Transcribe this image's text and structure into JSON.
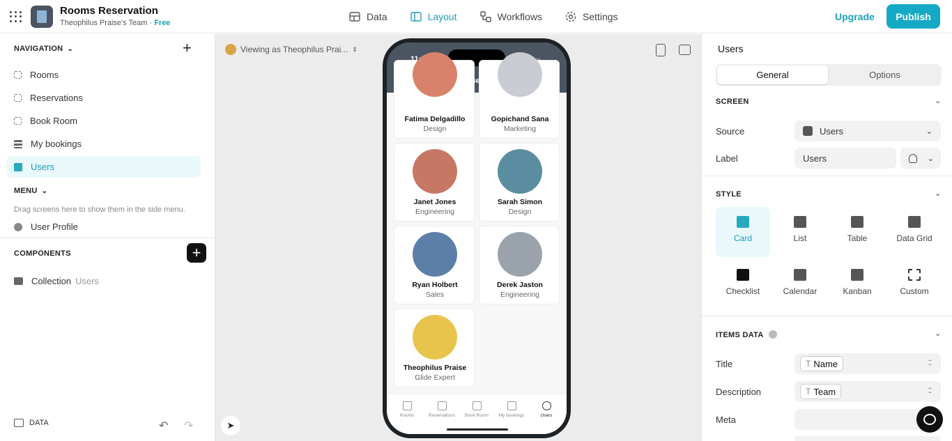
{
  "app": {
    "title": "Rooms Reservation",
    "team": "Theophilus Praise's Team",
    "plan": "Free",
    "separator": " · "
  },
  "tabs": [
    {
      "label": "Data"
    },
    {
      "label": "Layout"
    },
    {
      "label": "Workflows"
    },
    {
      "label": "Settings"
    }
  ],
  "header": {
    "upgrade": "Upgrade",
    "publish": "Publish"
  },
  "left": {
    "navigation_header": "NAVIGATION",
    "nav_items": [
      {
        "label": "Rooms"
      },
      {
        "label": "Reservations"
      },
      {
        "label": "Book Room"
      },
      {
        "label": "My bookings"
      },
      {
        "label": "Users"
      }
    ],
    "menu_header": "MENU",
    "menu_hint": "Drag screens here to show them in the side menu.",
    "menu_item": "User Profile",
    "components_header": "COMPONENTS",
    "component": {
      "label": "Collection",
      "source": "Users"
    },
    "data_label": "DATA"
  },
  "canvas": {
    "viewing_as": "Viewing as Theophilus Prai...",
    "phone": {
      "time": "11:57",
      "title": "Users",
      "users": [
        {
          "name": "Fatima Delgadillo",
          "team": "Design"
        },
        {
          "name": "Gopichand Sana",
          "team": "Marketing"
        },
        {
          "name": "Janet Jones",
          "team": "Engineering"
        },
        {
          "name": "Sarah Simon",
          "team": "Design"
        },
        {
          "name": "Ryan Holbert",
          "team": "Sales"
        },
        {
          "name": "Derek Jaston",
          "team": "Engineering"
        },
        {
          "name": "Theophilus Praise",
          "team": "Glide Expert"
        }
      ],
      "bottom_nav": [
        {
          "label": "Rooms"
        },
        {
          "label": "Reservations"
        },
        {
          "label": "Book Room"
        },
        {
          "label": "My bookings"
        },
        {
          "label": "Users"
        }
      ]
    }
  },
  "right": {
    "title": "Users",
    "segments": [
      {
        "label": "General"
      },
      {
        "label": "Options"
      }
    ],
    "screen_header": "SCREEN",
    "source_label": "Source",
    "source_value": "Users",
    "label_label": "Label",
    "label_value": "Users",
    "style_header": "STYLE",
    "styles": [
      {
        "label": "Card"
      },
      {
        "label": "List"
      },
      {
        "label": "Table"
      },
      {
        "label": "Data Grid"
      },
      {
        "label": "Checklist"
      },
      {
        "label": "Calendar"
      },
      {
        "label": "Kanban"
      },
      {
        "label": "Custom"
      }
    ],
    "items_header": "ITEMS DATA",
    "title_label": "Title",
    "title_value": "Name",
    "description_label": "Description",
    "description_value": "Team",
    "meta_label": "Meta"
  },
  "colors": {
    "accent": "#15a9c6",
    "phone_header": "#4a5561",
    "active_bg": "#e8f8fb"
  }
}
